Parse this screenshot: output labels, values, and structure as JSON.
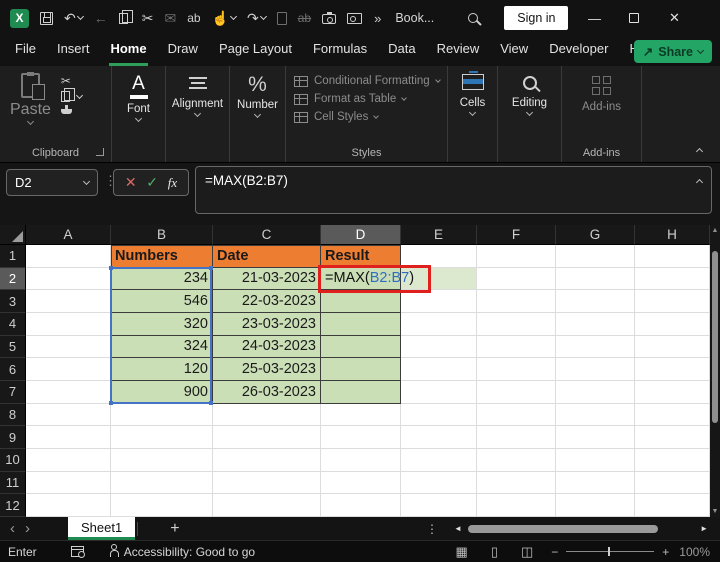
{
  "window": {
    "workbook_name": "Book...",
    "sign_in_label": "Sign in",
    "overflow_glyph": "»",
    "minimize_glyph": "—",
    "close_glyph": "✕"
  },
  "qat": [
    {
      "name": "excel-logo",
      "type": "logo",
      "text": "X"
    },
    {
      "name": "save-icon",
      "css": "ic-save"
    },
    {
      "name": "undo-button",
      "glyph": "↶",
      "dropdown": true
    },
    {
      "name": "back-icon",
      "glyph": "←",
      "disabled": true
    },
    {
      "name": "copy-icon",
      "css": "ic-copy"
    },
    {
      "name": "cut-icon",
      "glyph": "✂"
    },
    {
      "name": "mail-icon",
      "glyph": "✉",
      "disabled": true
    },
    {
      "name": "spelling-icon",
      "text": "ab"
    },
    {
      "name": "touch-mode-icon",
      "glyph": "☝",
      "dropdown": true
    },
    {
      "name": "redo-button",
      "glyph": "↷",
      "dropdown": true
    },
    {
      "name": "new-file-icon",
      "css": "ic-page",
      "disabled": true
    },
    {
      "name": "strikethrough-icon",
      "text": "ab",
      "disabled": true,
      "strike": true
    },
    {
      "name": "camera-icon",
      "css": "ic-camera"
    },
    {
      "name": "lookup-icon",
      "css": "ic-card"
    }
  ],
  "ribbon": {
    "tabs": [
      {
        "label": "File"
      },
      {
        "label": "Insert"
      },
      {
        "label": "Home",
        "active": true
      },
      {
        "label": "Draw"
      },
      {
        "label": "Page Layout"
      },
      {
        "label": "Formulas"
      },
      {
        "label": "Data"
      },
      {
        "label": "Review"
      },
      {
        "label": "View"
      },
      {
        "label": "Developer"
      },
      {
        "label": "Help"
      }
    ],
    "share_label": "Share",
    "clipboard": {
      "paste": "Paste",
      "label": "Clipboard"
    },
    "font_label": "Font",
    "alignment_label": "Alignment",
    "number_label": "Number",
    "styles": {
      "items": [
        "Conditional Formatting",
        "Format as Table",
        "Cell Styles"
      ],
      "label": "Styles"
    },
    "cells_label": "Cells",
    "editing_label": "Editing",
    "addins": {
      "button": "Add-ins",
      "label": "Add-ins"
    }
  },
  "formula_bar": {
    "name_box": "D2",
    "fx_label": "fx",
    "cancel_glyph": "✕",
    "enter_glyph": "✓",
    "formula_prefix": "=MAX(",
    "formula_range": "B2:B7",
    "formula_suffix": ")"
  },
  "spreadsheet": {
    "columns": [
      "A",
      "B",
      "C",
      "D",
      "E",
      "F",
      "G",
      "H"
    ],
    "rows": [
      "1",
      "2",
      "3",
      "4",
      "5",
      "6",
      "7",
      "8",
      "9",
      "10",
      "11",
      "12"
    ],
    "selected_column": "D",
    "selected_row": "2",
    "table": {
      "headers": [
        {
          "ref": "B1",
          "text": "Numbers"
        },
        {
          "ref": "C1",
          "text": "Date"
        },
        {
          "ref": "D1",
          "text": "Result"
        }
      ],
      "numbers_col": "B",
      "numbers": [
        "234",
        "546",
        "320",
        "324",
        "120",
        "900"
      ],
      "dates_col": "C",
      "dates": [
        "21-03-2023",
        "22-03-2023",
        "23-03-2023",
        "24-03-2023",
        "25-03-2023",
        "26-03-2023"
      ],
      "result_cells": [
        "D3",
        "D4",
        "D5",
        "D6",
        "D7"
      ],
      "formula_cell": "D2",
      "formula": {
        "prefix": "=MAX(",
        "range": "B2:B7",
        "suffix": ")"
      },
      "highlight_cell": "E2"
    },
    "colors": {
      "header_fill": "#ED7D31",
      "data_fill": "#CBDFB7",
      "highlight_fill": "#DCE9CF",
      "range_border": "#4472C4",
      "annotation_border": "#E0201C",
      "formula_range_text": "#2F6FC0",
      "accent_green": "#1f8b51"
    }
  },
  "sheet_bar": {
    "tab": "Sheet1",
    "add_label": "+",
    "prev_glyph": "‹",
    "next_glyph": "›"
  },
  "status_bar": {
    "mode": "Enter",
    "accessibility": "Accessibility: Good to go",
    "zoom": "100%",
    "zoom_minus": "−",
    "zoom_plus": "+",
    "view_normal_glyph": "▦",
    "view_page_glyph": "▯",
    "view_break_glyph": "◫"
  }
}
